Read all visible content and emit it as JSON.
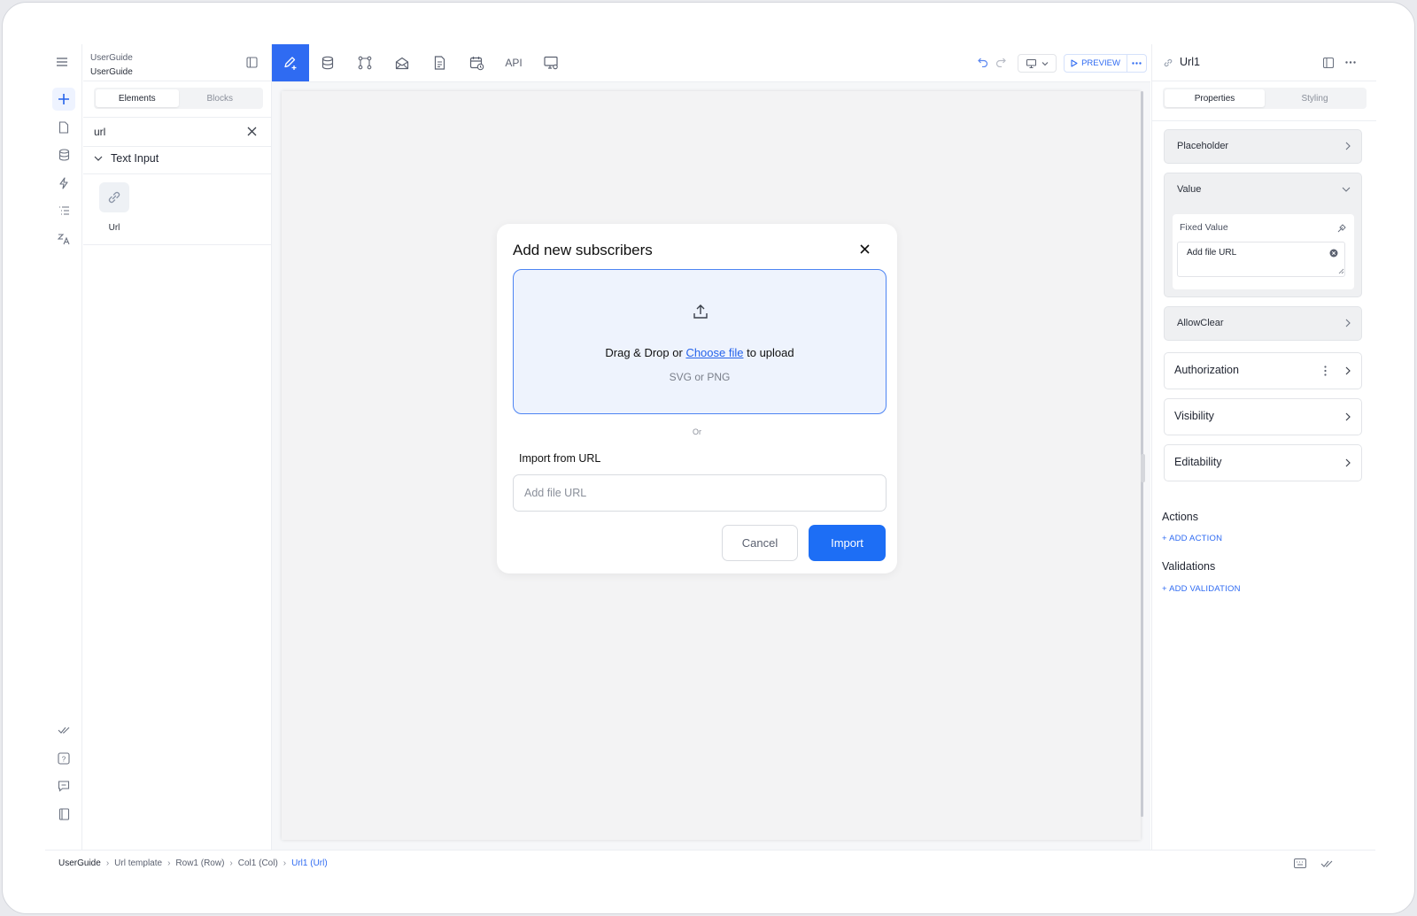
{
  "project": {
    "line1": "UserGuide",
    "line2": "UserGuide"
  },
  "left_panel": {
    "tabs": [
      "Elements",
      "Blocks"
    ],
    "search_value": "url",
    "group_label": "Text Input",
    "element_label": "Url"
  },
  "toolbar": {
    "api_label": "API",
    "preview_label": "PREVIEW"
  },
  "modal": {
    "title": "Add new subscribers",
    "drop_prefix": "Drag & Drop or",
    "drop_link": "Choose file",
    "drop_suffix": "to upload",
    "drop_sub": "SVG or PNG",
    "or": "Or",
    "import_label": "Import from URL",
    "url_placeholder": "Add file URL",
    "cancel": "Cancel",
    "import": "Import"
  },
  "right_panel": {
    "component_name": "Url1",
    "tabs": [
      "Properties",
      "Styling"
    ],
    "placeholder": "Placeholder",
    "value": "Value",
    "fixed_value_label": "Fixed Value",
    "fixed_value": "Add file URL",
    "allow_clear": "AllowClear",
    "authorization": "Authorization",
    "visibility": "Visibility",
    "editability": "Editability",
    "actions_heading": "Actions",
    "add_action": "+ ADD ACTION",
    "validations_heading": "Validations",
    "add_validation": "+ ADD VALIDATION"
  },
  "breadcrumbs": [
    "UserGuide",
    "Url template",
    "Row1 (Row)",
    "Col1 (Col)",
    "Url1 (Url)"
  ],
  "colors": {
    "accent": "#2f6bf2",
    "import_button": "#1d6ef5",
    "dropzone_bg": "#eef3fd"
  }
}
